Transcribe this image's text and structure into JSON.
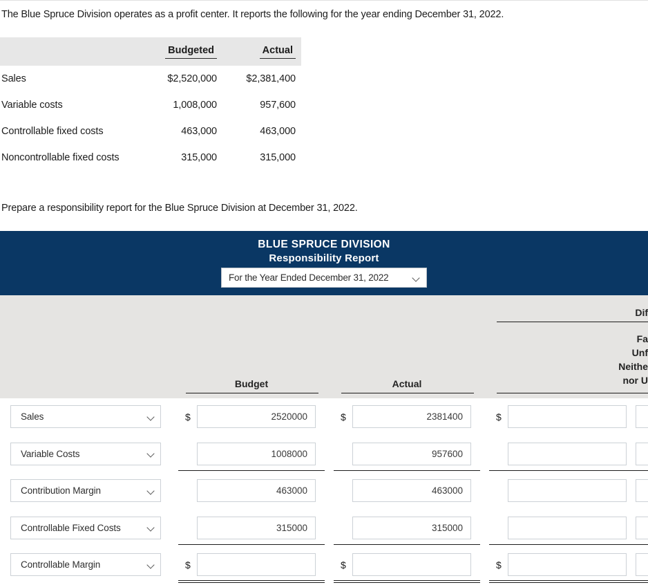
{
  "prompt": {
    "line1": "The Blue Spruce Division operates as a profit center. It reports the following for the year ending December 31, 2022.",
    "line2": "Prepare a responsibility report for the Blue Spruce Division at December 31, 2022."
  },
  "given_table": {
    "columns": [
      "",
      "Budgeted",
      "Actual"
    ],
    "rows": [
      {
        "label": "Sales",
        "budgeted": "$2,520,000",
        "actual": "$2,381,400"
      },
      {
        "label": "Variable costs",
        "budgeted": "1,008,000",
        "actual": "957,600"
      },
      {
        "label": "Controllable fixed costs",
        "budgeted": "463,000",
        "actual": "463,000"
      },
      {
        "label": "Noncontrollable fixed costs",
        "budgeted": "315,000",
        "actual": "315,000"
      }
    ]
  },
  "report": {
    "company": "BLUE SPRUCE DIVISION",
    "report_title": "Responsibility Report",
    "period_selected": "For the Year Ended December 31, 2022",
    "period_options": [
      "For the Year Ended December 31, 2022"
    ],
    "header_navy": "#0a3764",
    "body_gray": "#e5e4e2",
    "columns": {
      "budget": "Budget",
      "actual": "Actual",
      "difference": "Dif",
      "diff_line1": "Fa",
      "diff_line2": "Unf",
      "diff_line3": "Neithe",
      "diff_line4": "nor U"
    },
    "rows": [
      {
        "label": "Sales",
        "dollar": "$",
        "budget": "2520000",
        "actual": "2381400",
        "difference": "",
        "fourth": ""
      },
      {
        "label": "Variable Costs",
        "dollar": "",
        "budget": "1008000",
        "actual": "957600",
        "difference": "",
        "fourth": ""
      },
      {
        "label": "Contribution Margin",
        "dollar": "",
        "budget": "463000",
        "actual": "463000",
        "difference": "",
        "fourth": ""
      },
      {
        "label": "Controllable Fixed Costs",
        "dollar": "",
        "budget": "315000",
        "actual": "315000",
        "difference": "",
        "fourth": ""
      },
      {
        "label": "Controllable Margin",
        "dollar": "$",
        "budget": "",
        "actual": "",
        "difference": "",
        "fourth": ""
      }
    ],
    "row_options": [
      "Sales",
      "Variable Costs",
      "Contribution Margin",
      "Controllable Fixed Costs",
      "Controllable Margin"
    ]
  }
}
